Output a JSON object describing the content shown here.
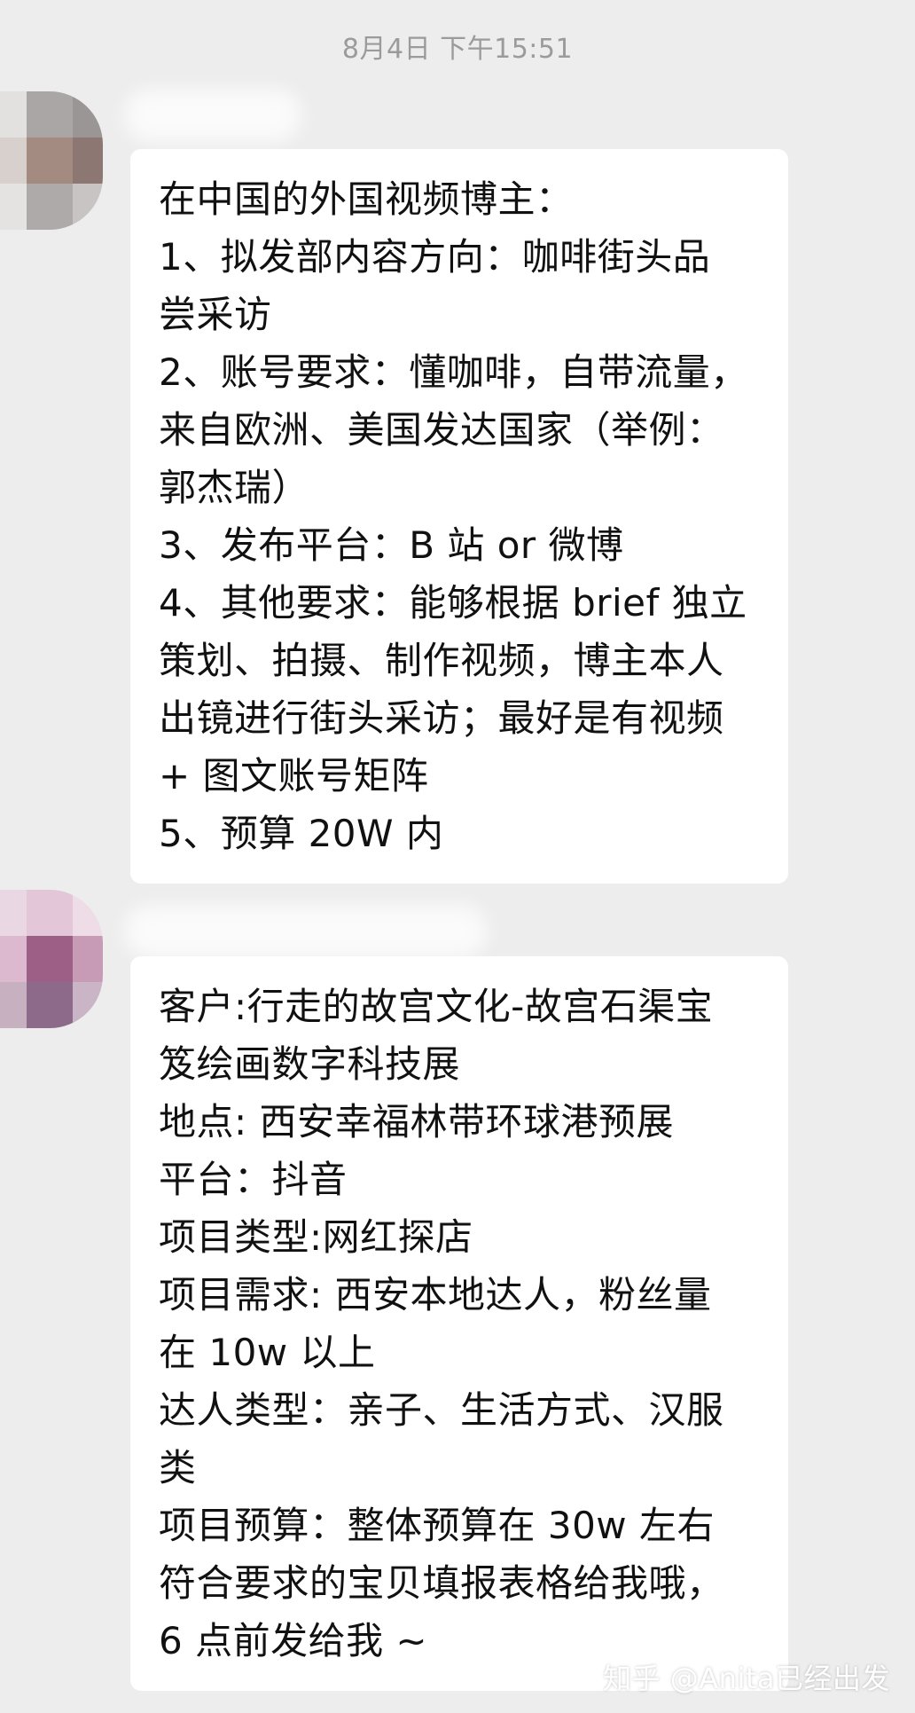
{
  "timestamp": "8月4日 下午15:51",
  "messages": [
    {
      "lines": [
        "在中国的外国视频博主：",
        "1、拟发部内容方向：咖啡街头品",
        "尝采访",
        "2、账号要求：懂咖啡，自带流量，",
        "来自欧洲、美国发达国家（举例：",
        "郭杰瑞）",
        "3、发布平台：B 站 or 微博",
        "4、其他要求：能够根据 brief 独立",
        "策划、拍摄、制作视频，博主本人",
        "出镜进行街头采访；最好是有视频",
        "+ 图文账号矩阵",
        "5、预算 20W 内"
      ]
    },
    {
      "lines": [
        "客户:行走的故宫文化-故宫石渠宝",
        "笈绘画数字科技展",
        "地点: 西安幸福林带环球港预展",
        "平台：抖音",
        "项目类型:网红探店",
        "项目需求: 西安本地达人，粉丝量",
        "在 10w 以上",
        "达人类型：亲子、生活方式、汉服",
        "类",
        "项目预算：整体预算在 30w 左右",
        "符合要求的宝贝填报表格给我哦，",
        "6 点前发给我 ~"
      ]
    }
  ],
  "watermark": "知乎 @Anita已经出发"
}
